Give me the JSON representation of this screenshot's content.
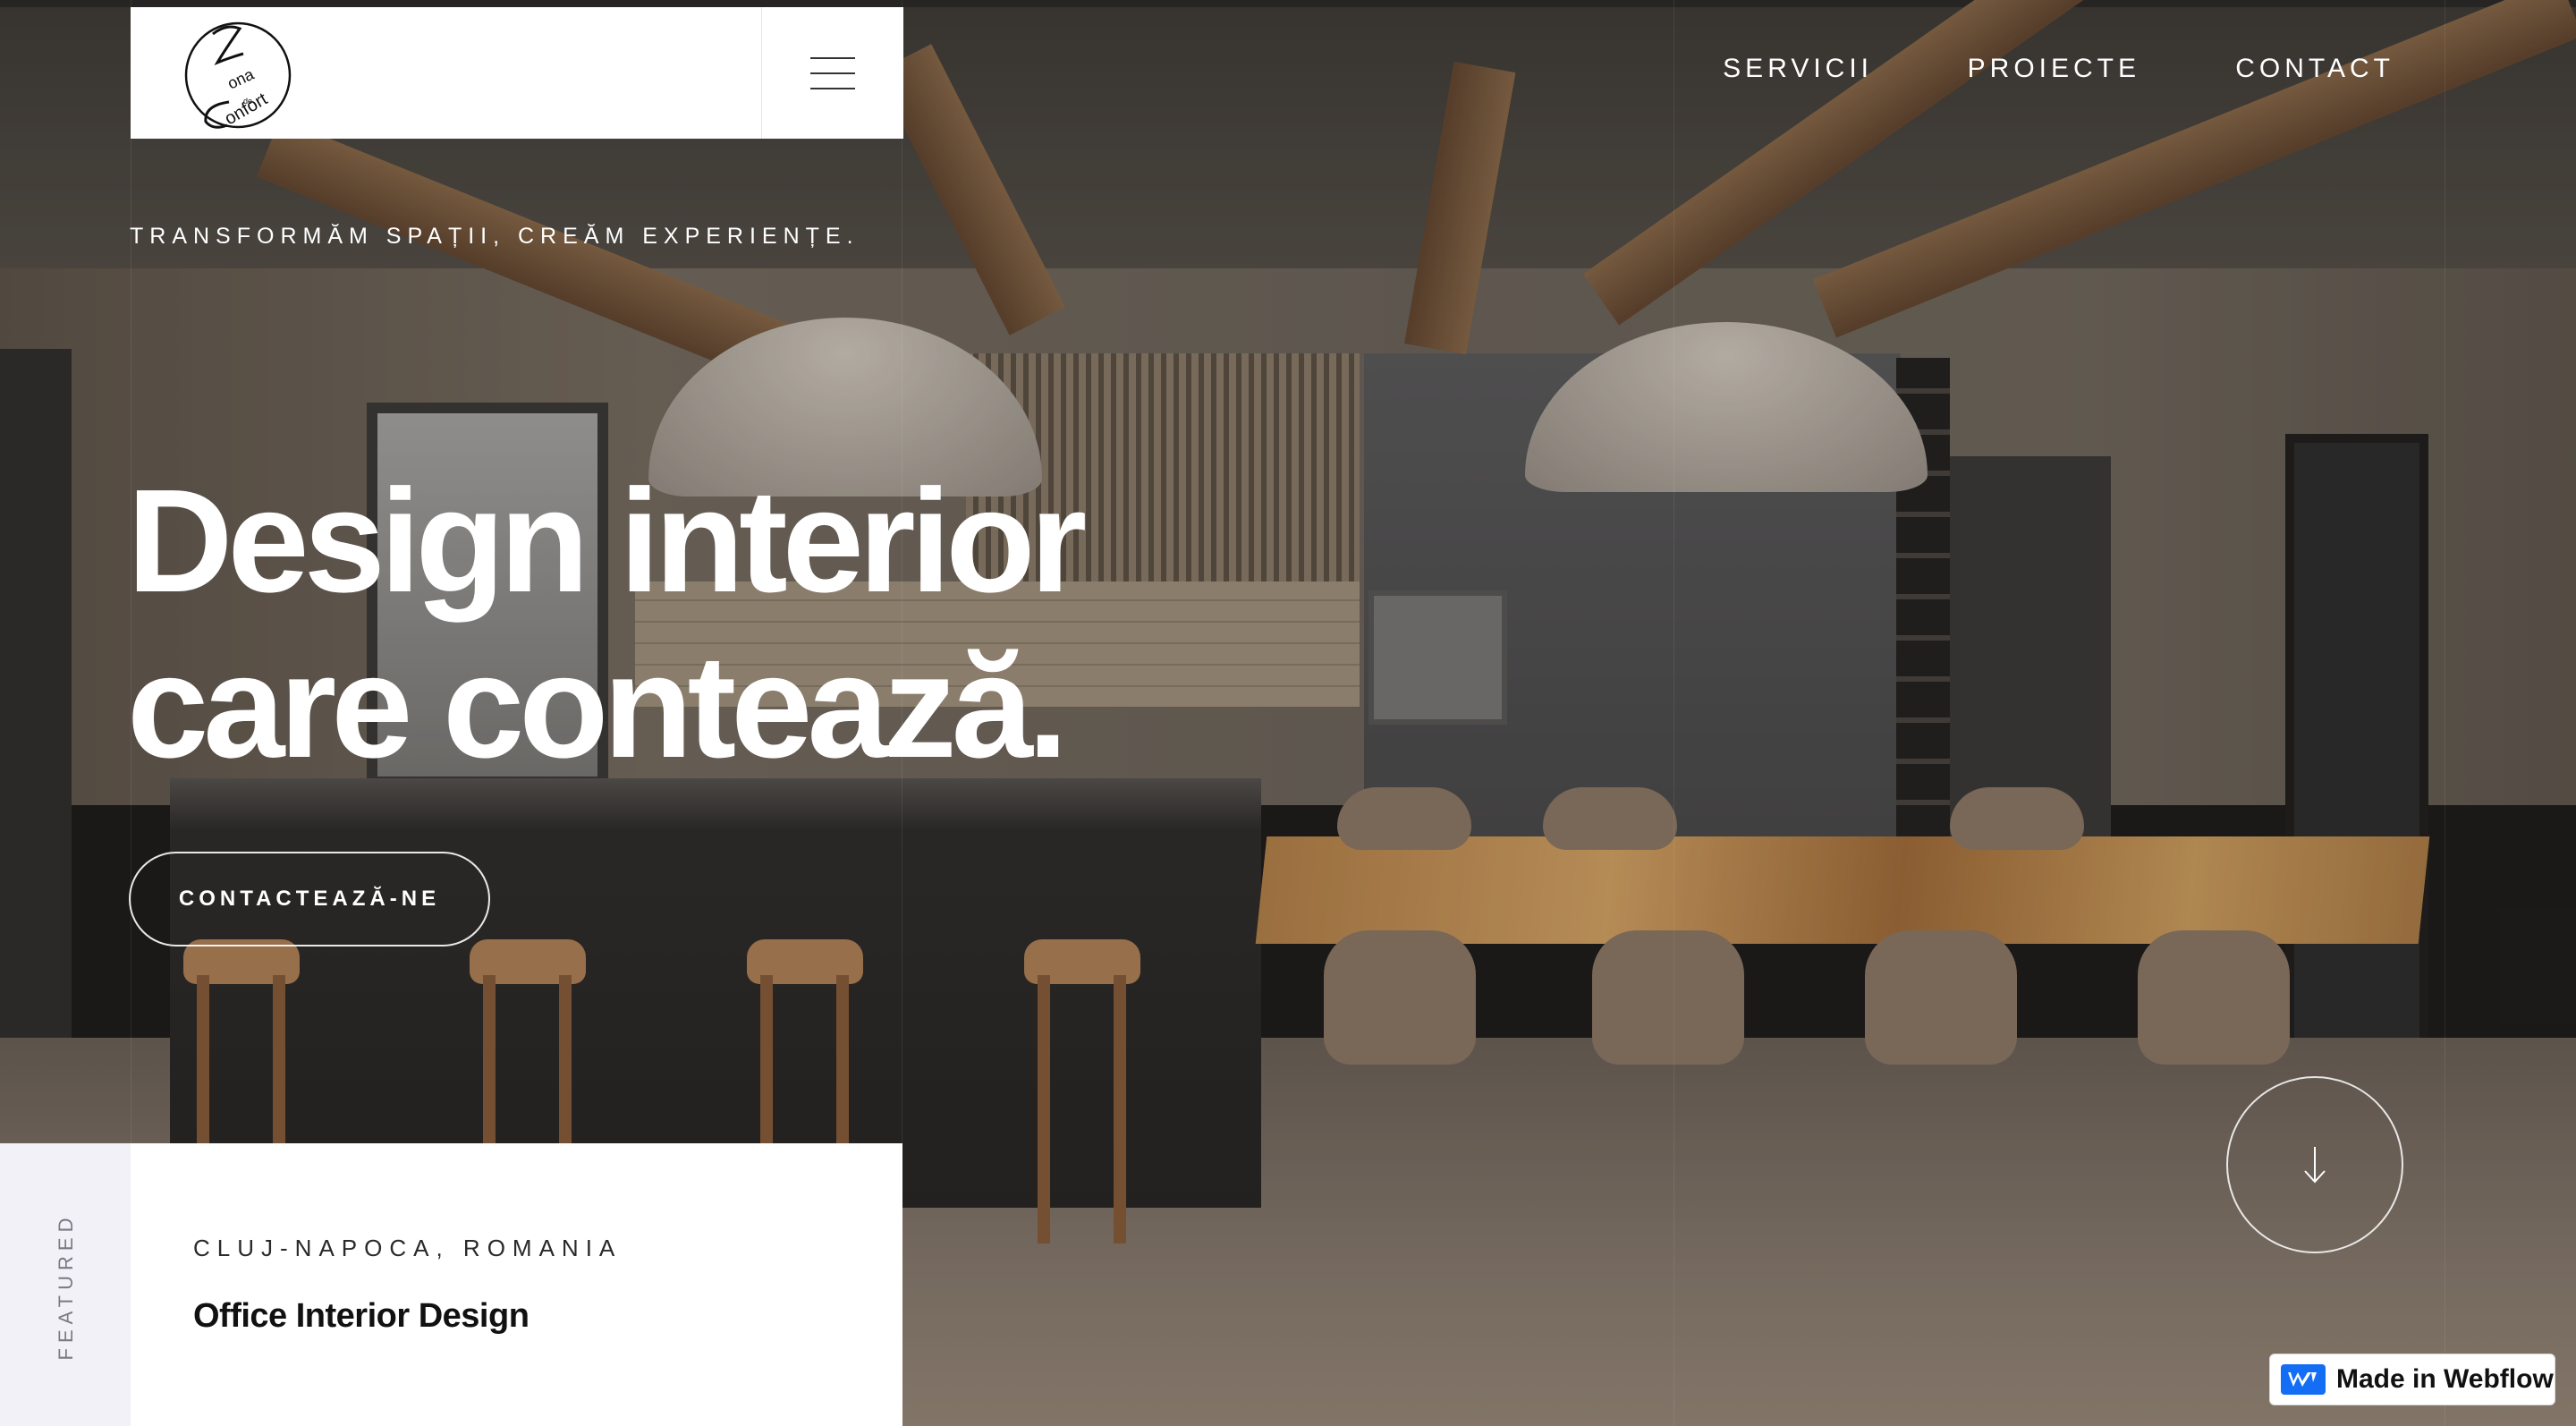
{
  "colors": {
    "accent": "#ffffff",
    "card_background": "#ffffff",
    "featured_sidebar": "#f1f1f7",
    "webflow_blue": "#146ef5"
  },
  "header": {
    "logo_icon": "zona-confort-logo",
    "menu_icon": "hamburger-menu-icon",
    "nav": [
      {
        "label": "SERVICII"
      },
      {
        "label": "PROIECTE"
      },
      {
        "label": "CONTACT"
      }
    ]
  },
  "hero": {
    "tagline": "TRANSFORMĂM SPAȚII, CREĂM EXPERIENȚE.",
    "title_line1": "Design interior",
    "title_line2": "care contează.",
    "cta_label": "CONTACTEAZĂ-NE",
    "scroll_icon": "arrow-down-icon"
  },
  "featured": {
    "side_label": "FEATURED",
    "location": "CLUJ-NAPOCA, ROMANIA",
    "project_title": "Office Interior Design"
  },
  "badge": {
    "icon": "webflow-logo-icon",
    "label": "Made in Webflow"
  }
}
